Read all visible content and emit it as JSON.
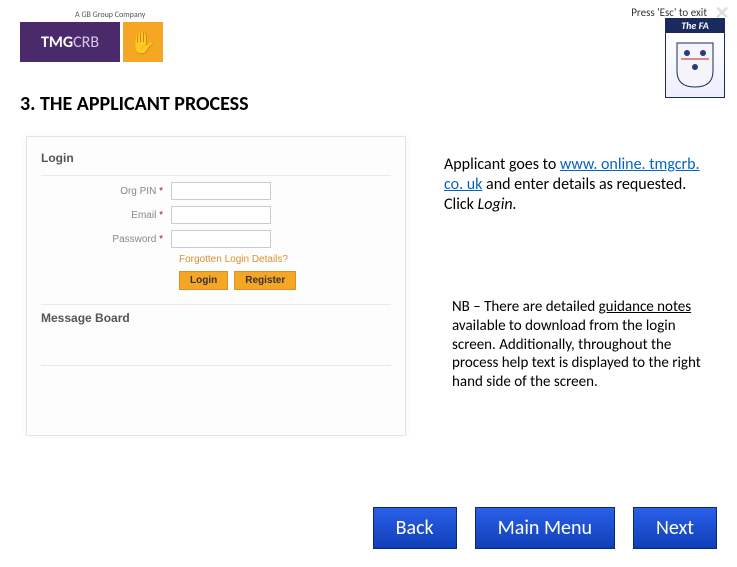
{
  "header": {
    "esc_text": "Press 'Esc' to exit",
    "close_glyph": "✕",
    "fa_bar": "The FA",
    "tmg_tagline": "A GB Group Company",
    "tmg_bold": "TMG",
    "tmg_light": "CRB",
    "hand_glyph": "✋"
  },
  "section_title": "3. THE APPLICANT PROCESS",
  "login_panel": {
    "title": "Login",
    "fields": {
      "org_pin": "Org PIN",
      "email": "Email",
      "password": "Password"
    },
    "asterisk": "*",
    "forgot": "Forgotten Login Details?",
    "login_btn": "Login",
    "register_btn": "Register",
    "message_board": "Message Board"
  },
  "instructions": {
    "line1a": "Applicant goes to ",
    "url": "www. online. tmgcrb. co. uk",
    "line1b": " and enter details as requested. Click ",
    "login_word": "Login.",
    "nb_prefix": "NB – There are detailed ",
    "nb_underline": "guidance notes",
    "nb_rest": " available to download from the login screen. Additionally, throughout the process help text is displayed to the right hand side of the screen."
  },
  "nav": {
    "back": "Back",
    "main_menu": "Main Menu",
    "next": "Next"
  }
}
